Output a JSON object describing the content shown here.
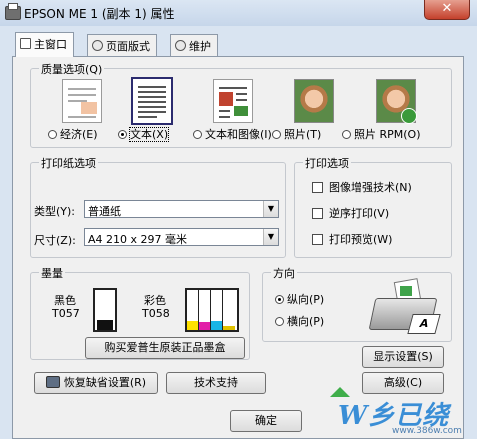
{
  "window": {
    "title": "EPSON ME 1 (副本 1) 属性",
    "close_glyph": "✕"
  },
  "tabs": [
    {
      "label": "主窗口",
      "icon": "main-window-icon",
      "active": true
    },
    {
      "label": "页面版式",
      "icon": "page-layout-icon",
      "active": false
    },
    {
      "label": "维护",
      "icon": "maintenance-icon",
      "active": false
    }
  ],
  "quality": {
    "title": "质量选项(Q)",
    "options": [
      {
        "label": "经济(E)",
        "icon": "economy-doc-icon",
        "selected": false
      },
      {
        "label": "文本(X)",
        "icon": "text-doc-icon",
        "selected": true
      },
      {
        "label": "文本和图像(I)",
        "icon": "text-image-doc-icon",
        "selected": false
      },
      {
        "label": "照片(T)",
        "icon": "photo-icon",
        "selected": false
      },
      {
        "label": "照片 RPM(O)",
        "icon": "photo-rpm-icon",
        "selected": false
      }
    ]
  },
  "paper": {
    "title": "打印纸选项",
    "type_label": "类型(Y):",
    "type_value": "普通纸",
    "size_label": "尺寸(Z):",
    "size_value": "A4 210 x 297 毫米"
  },
  "print_options": {
    "title": "打印选项",
    "items": [
      {
        "label": "图像增强技术(N)",
        "checked": false
      },
      {
        "label": "逆序打印(V)",
        "checked": false
      },
      {
        "label": "打印预览(W)",
        "checked": false
      }
    ]
  },
  "ink": {
    "title": "墨量",
    "black_label": "黑色",
    "black_code": "T057",
    "color_label": "彩色",
    "color_code": "T058",
    "black_level": 0.25,
    "color_levels": [
      {
        "color": "#ffe100",
        "level": 0.22
      },
      {
        "color": "#e21fa8",
        "level": 0.2
      },
      {
        "color": "#19b5e6",
        "level": 0.22
      },
      {
        "color": "#e0c200",
        "level": 0.1
      }
    ],
    "buy_button": "购买爱普生原装正品墨盒"
  },
  "orientation": {
    "title": "方向",
    "portrait": "纵向(P)",
    "landscape": "横向(P)",
    "selected": "portrait",
    "page_letter": "A"
  },
  "buttons": {
    "restore_defaults": "恢复缺省设置(R)",
    "tech_support": "技术支持",
    "show_settings": "显示设置(S)",
    "advanced": "高级(C)",
    "ok": "确定"
  },
  "watermark": {
    "text": "W乡已绕",
    "url": "www.386w.com"
  },
  "colors": {
    "dialog_bg": "#f0f0f0",
    "frame": "#d9e4f1",
    "close_red": "#c4412c"
  }
}
